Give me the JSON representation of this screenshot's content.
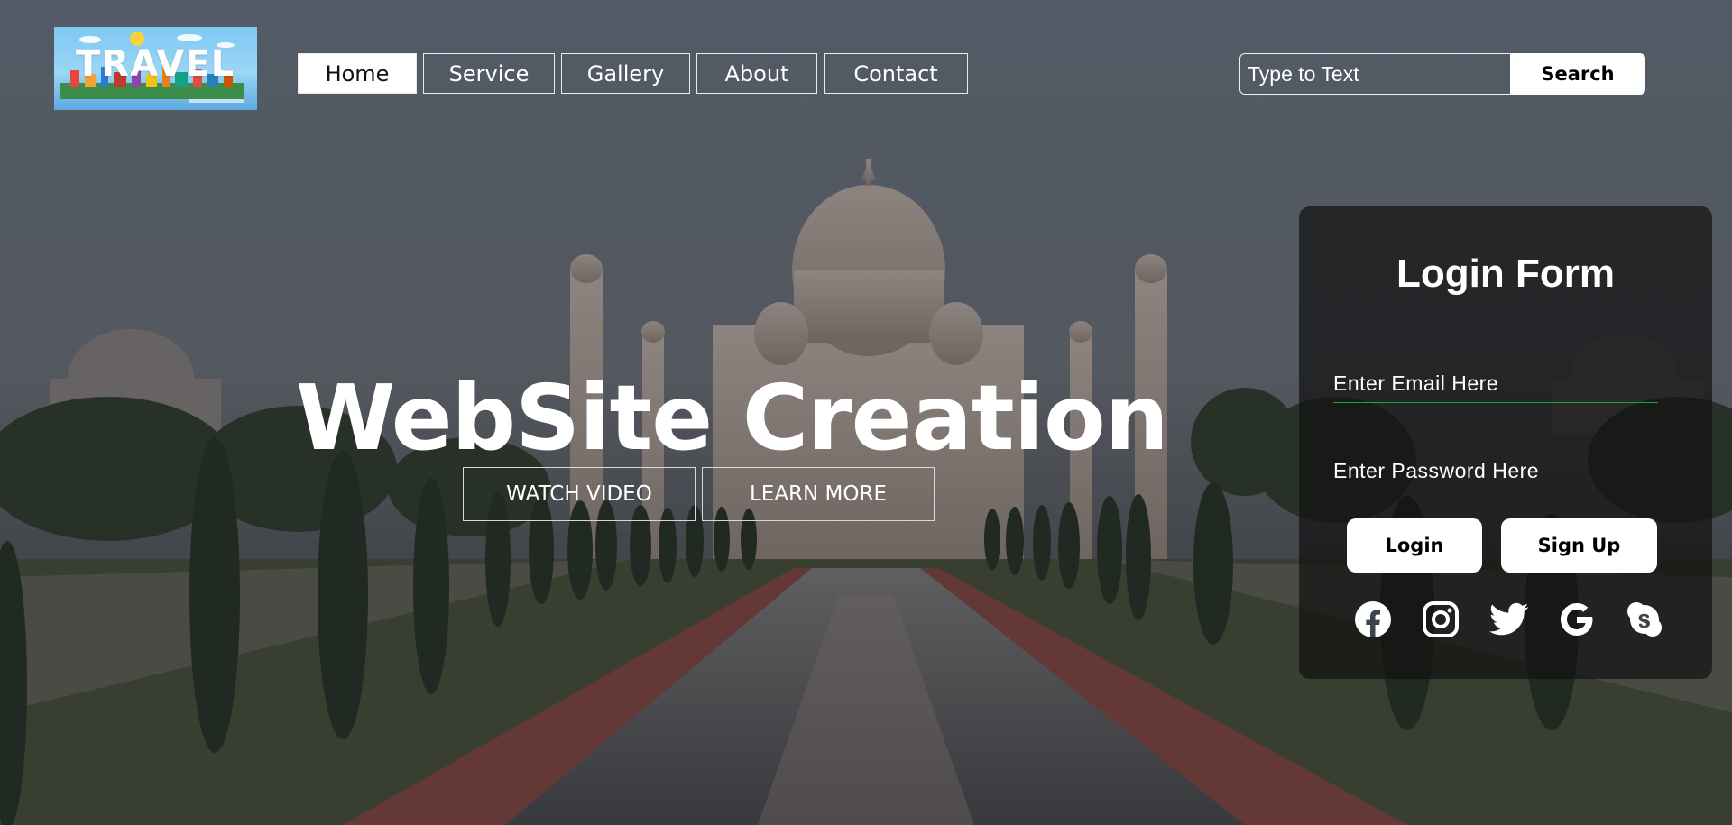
{
  "header": {
    "logo_text": "TRAVEL",
    "nav": [
      {
        "label": "Home",
        "active": true
      },
      {
        "label": "Service",
        "active": false
      },
      {
        "label": "Gallery",
        "active": false
      },
      {
        "label": "About",
        "active": false
      },
      {
        "label": "Contact",
        "active": false
      }
    ],
    "search": {
      "placeholder": "Type to Text",
      "value": "",
      "button_label": "Search"
    }
  },
  "hero": {
    "title": "WebSite Creation",
    "buttons": [
      "WATCH VIDEO",
      "LEARN MORE"
    ]
  },
  "login_form": {
    "title": "Login Form",
    "email_placeholder": "Enter Email Here",
    "password_placeholder": "Enter Password Here",
    "login_label": "Login",
    "signup_label": "Sign Up",
    "social_icons": [
      "facebook-icon",
      "instagram-icon",
      "twitter-icon",
      "google-icon",
      "skype-icon"
    ]
  },
  "colors": {
    "overlay": "#3d444c",
    "input_underline": "#1aa53a",
    "button_background": "#ffffff"
  }
}
